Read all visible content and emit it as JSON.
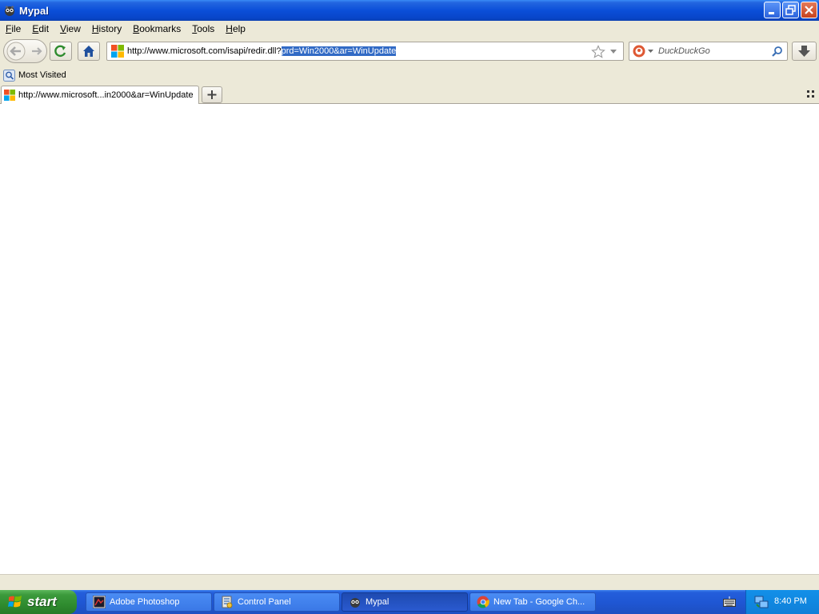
{
  "window": {
    "title": "Mypal"
  },
  "menu": [
    {
      "label": "File",
      "accel": "F",
      "rest": "ile"
    },
    {
      "label": "Edit",
      "accel": "E",
      "rest": "dit"
    },
    {
      "label": "View",
      "accel": "V",
      "rest": "iew"
    },
    {
      "label": "History",
      "accel": "H",
      "rest": "istory"
    },
    {
      "label": "Bookmarks",
      "accel": "B",
      "rest": "ookmarks"
    },
    {
      "label": "Tools",
      "accel": "T",
      "rest": "ools"
    },
    {
      "label": "Help",
      "accel": "H",
      "rest": "elp"
    }
  ],
  "address": {
    "url_plain": "http://www.microsoft.com/isapi/redir.dll?",
    "url_selected": "prd=Win2000&ar=WinUpdate"
  },
  "search": {
    "placeholder": "DuckDuckGo",
    "engine_icon": "duckduckgo-icon"
  },
  "bookmarks": {
    "items": [
      {
        "label": "Most Visited"
      }
    ]
  },
  "tabs": [
    {
      "label": "http://www.microsoft...in2000&ar=WinUpdate",
      "active": true
    }
  ],
  "taskbar": {
    "start_label": "start",
    "tasks": [
      {
        "label": "Adobe Photoshop",
        "active": false
      },
      {
        "label": "Control Panel",
        "active": false
      },
      {
        "label": "Mypal",
        "active": true
      },
      {
        "label": "New Tab - Google Ch...",
        "active": false
      }
    ],
    "clock": "8:40 PM"
  },
  "colors": {
    "titlebar": "#0b4fd9",
    "chrome": "#ece9d8",
    "selection": "#316ac5",
    "taskbar": "#245edb",
    "start": "#3c9a3c"
  }
}
